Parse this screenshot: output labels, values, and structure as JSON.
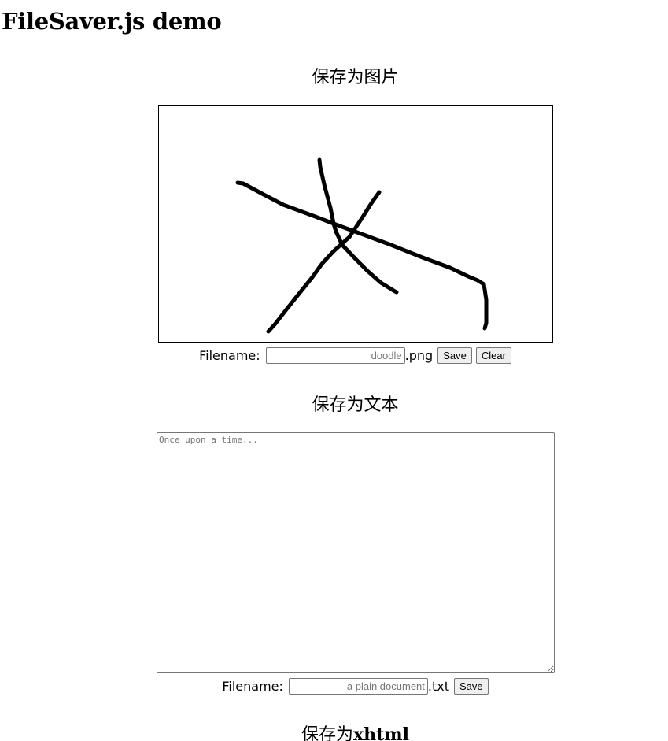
{
  "page": {
    "title": "FileSaver.js demo"
  },
  "image_section": {
    "heading": "保存为图片",
    "filename_label": "Filename:",
    "filename_value": "",
    "filename_placeholder": "doodle",
    "extension": ".png",
    "save_label": "Save",
    "clear_label": "Clear",
    "stroke_color": "#000000"
  },
  "text_section": {
    "heading": "保存为文本",
    "textarea_value": "",
    "textarea_placeholder": "Once upon a time...",
    "filename_label": "Filename:",
    "filename_value": "",
    "filename_placeholder": "a plain document",
    "extension": ".txt",
    "save_label": "Save"
  },
  "xhtml_section": {
    "heading_prefix": "保存为",
    "heading_bold": "xhtml"
  }
}
